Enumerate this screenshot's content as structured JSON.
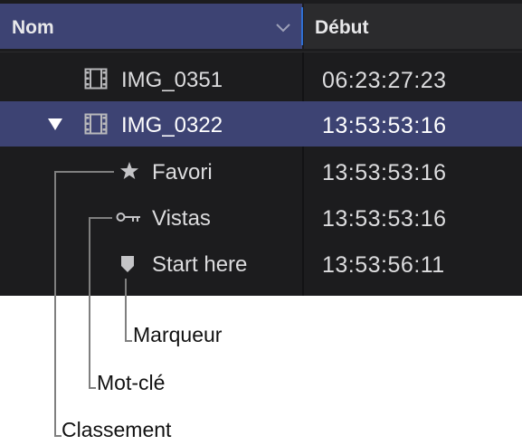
{
  "header": {
    "name_column": "Nom",
    "start_column": "Début"
  },
  "rows": [
    {
      "name": "IMG_0351",
      "start": "06:23:27:23",
      "icon": "film-clip-icon"
    },
    {
      "name": "IMG_0322",
      "start": "13:53:53:16",
      "icon": "film-clip-icon",
      "expanded": true,
      "selected": true
    },
    {
      "name": "Favori",
      "start": "13:53:53:16",
      "icon": "star-icon"
    },
    {
      "name": "Vistas",
      "start": "13:53:53:16",
      "icon": "key-icon"
    },
    {
      "name": "Start here",
      "start": "13:53:56:11",
      "icon": "marker-icon"
    }
  ],
  "callouts": {
    "marker": "Marqueur",
    "keyword": "Mot-clé",
    "rating": "Classement"
  },
  "colors": {
    "panel_background": "#1c1c1e",
    "selection": "#3d4373",
    "header_start": "#2b2b2d",
    "focus_line": "#2f6fd2",
    "text": "#dcdcde",
    "leader_line": "#7f7f7f"
  }
}
